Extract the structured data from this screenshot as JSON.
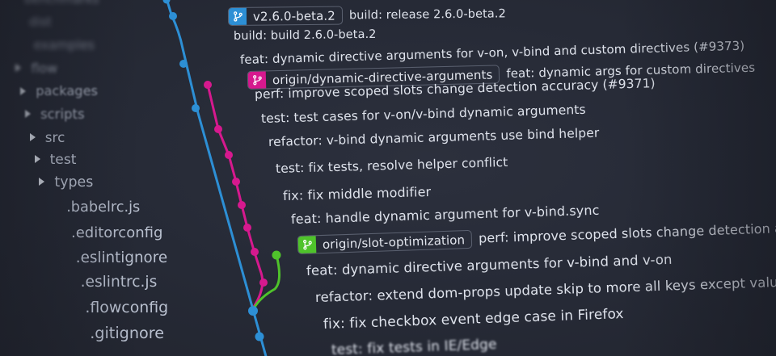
{
  "sidebar": {
    "items": [
      {
        "label": "benchmarks",
        "folder": false
      },
      {
        "label": "dist",
        "folder": false
      },
      {
        "label": "examples",
        "folder": false
      },
      {
        "label": "flow",
        "folder": true
      },
      {
        "label": "packages",
        "folder": true
      },
      {
        "label": "scripts",
        "folder": true
      },
      {
        "label": "src",
        "folder": true
      },
      {
        "label": "test",
        "folder": true
      },
      {
        "label": "types",
        "folder": true
      },
      {
        "label": ".babelrc.js",
        "folder": false
      },
      {
        "label": ".editorconfig",
        "folder": false
      },
      {
        "label": ".eslintignore",
        "folder": false
      },
      {
        "label": ".eslintrc.js",
        "folder": false
      },
      {
        "label": ".flowconfig",
        "folder": false
      },
      {
        "label": ".gitignore",
        "folder": false
      }
    ]
  },
  "commits": [
    {
      "tag": "v2.6.0-beta.2",
      "tag_color": "#2d8fd5",
      "message": "build: release 2.6.0-beta.2"
    },
    {
      "tag": "",
      "message": "build: build 2.6.0-beta.2"
    },
    {
      "tag": "",
      "message": "feat: dynamic directive arguments for v-on, v-bind and custom directives (#9373)"
    },
    {
      "tag": "origin/dynamic-directive-arguments",
      "tag_color": "#d6198e",
      "message": "feat: dynamic args for custom directives"
    },
    {
      "tag": "",
      "message": "perf: improve scoped slots change detection accuracy (#9371)"
    },
    {
      "tag": "",
      "message": "test: test cases for v-on/v-bind dynamic arguments"
    },
    {
      "tag": "",
      "message": "refactor: v-bind dynamic arguments use bind helper"
    },
    {
      "tag": "",
      "message": "test: fix tests, resolve helper conflict"
    },
    {
      "tag": "",
      "message": "fix: fix middle modifier"
    },
    {
      "tag": "",
      "message": "feat: handle dynamic argument for v-bind.sync"
    },
    {
      "tag": "origin/slot-optimization",
      "tag_color": "#4fc32b",
      "message": "perf: improve scoped slots change detection accuracy"
    },
    {
      "tag": "",
      "message": "feat: dynamic directive arguments for v-bind and v-on"
    },
    {
      "tag": "",
      "message": "refactor: extend dom-props update skip to more all keys except value"
    },
    {
      "tag": "",
      "message": "fix: fix checkbox event edge case in Firefox"
    },
    {
      "tag": "",
      "message": "test: fix tests in IE/Edge"
    }
  ],
  "graph": {
    "colors": {
      "main": "#2d8fd5",
      "branch": "#d6198e",
      "slot": "#4fc32b"
    }
  },
  "icons": {
    "tag": "git-branch-icon",
    "folder": "triangle-right-icon"
  }
}
